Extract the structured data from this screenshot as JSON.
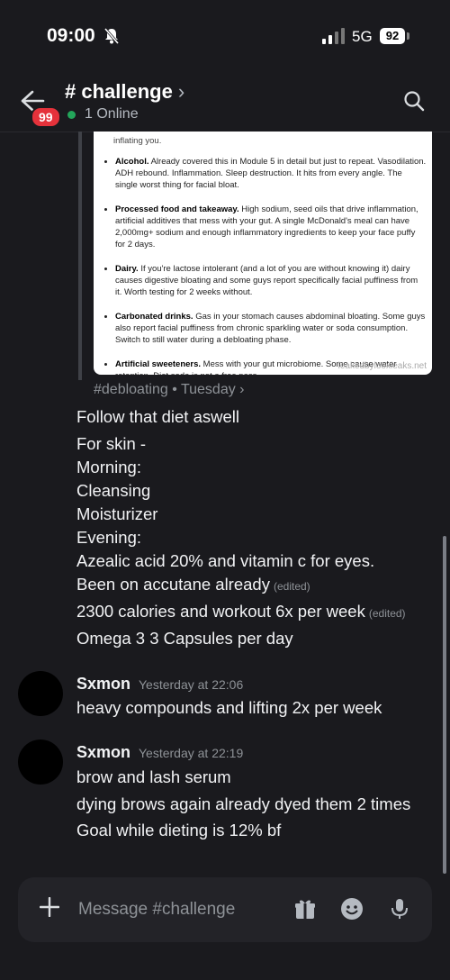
{
  "status_bar": {
    "time": "09:00",
    "network": "5G",
    "battery": "92"
  },
  "header": {
    "channel_name": "# challenge",
    "chevron": "›",
    "badge_count": "99",
    "online_text": "1 Online"
  },
  "embed": {
    "top_cut_text": "inflating you.",
    "items": [
      {
        "title": "Alcohol.",
        "body": " Already covered this in Module 5 in detail but just to repeat. Vasodilation. ADH rebound. Inflammation. Sleep destruction. It hits from every angle. The single worst thing for facial bloat."
      },
      {
        "title": "Processed food and takeaway.",
        "body": " High sodium, seed oils that drive inflammation, artificial additives that mess with your gut. A single McDonald's meal can have 2,000mg+ sodium and enough inflammatory ingredients to keep your face puffy for 2 days."
      },
      {
        "title": "Dairy.",
        "body": " If you're lactose intolerant (and a lot of you are without knowing it) dairy causes digestive bloating and some guys report specifically facial puffiness from it. Worth testing for 2 weeks without."
      },
      {
        "title": "Carbonated drinks.",
        "body": " Gas in your stomach causes abdominal bloating. Some guys also report facial puffiness from chronic sparkling water or soda consumption. Switch to still water during a debloating phase."
      },
      {
        "title": "Artificial sweeteners.",
        "body": " Mess with your gut microbiome. Some cause water retention. Diet soda is not a free pass."
      }
    ],
    "watermark": "leakedbylooxleaks.net"
  },
  "forward_source": "#debloating • Tuesday ›",
  "first_block": [
    {
      "text": "Follow that diet aswell",
      "edited": ""
    },
    {
      "text": "For skin -",
      "edited": ""
    },
    {
      "text": "Morning:",
      "edited": ""
    },
    {
      "text": "Cleansing",
      "edited": ""
    },
    {
      "text": "Moisturizer",
      "edited": ""
    },
    {
      "text": "Evening:",
      "edited": ""
    },
    {
      "text": "Azealic acid 20% and vitamin c for eyes.",
      "edited": ""
    },
    {
      "text": "Been on accutane already",
      "edited": "(edited)"
    },
    {
      "text": "2300 calories and workout 6x per week",
      "edited": "(edited)"
    },
    {
      "text": "Omega 3 3 Capsules per day",
      "edited": ""
    }
  ],
  "messages": [
    {
      "author": "Sxmon",
      "timestamp": "Yesterday at 22:06",
      "lines": [
        "heavy compounds and lifting 2x per week"
      ]
    },
    {
      "author": "Sxmon",
      "timestamp": "Yesterday at 22:19",
      "lines": [
        "brow and lash serum",
        "dying brows again already dyed them 2 times",
        "Goal while dieting is 12% bf"
      ]
    }
  ],
  "composer": {
    "placeholder": "Message #challenge"
  },
  "icons": {
    "back": "arrow-left-icon",
    "search": "search-icon",
    "plus": "plus-icon",
    "gift": "gift-icon",
    "emoji": "emoji-icon",
    "mic": "microphone-icon"
  },
  "colors": {
    "background": "#1a1a1e",
    "online": "#23a55a",
    "badge": "#e5323b",
    "muted": "#8e9297"
  }
}
